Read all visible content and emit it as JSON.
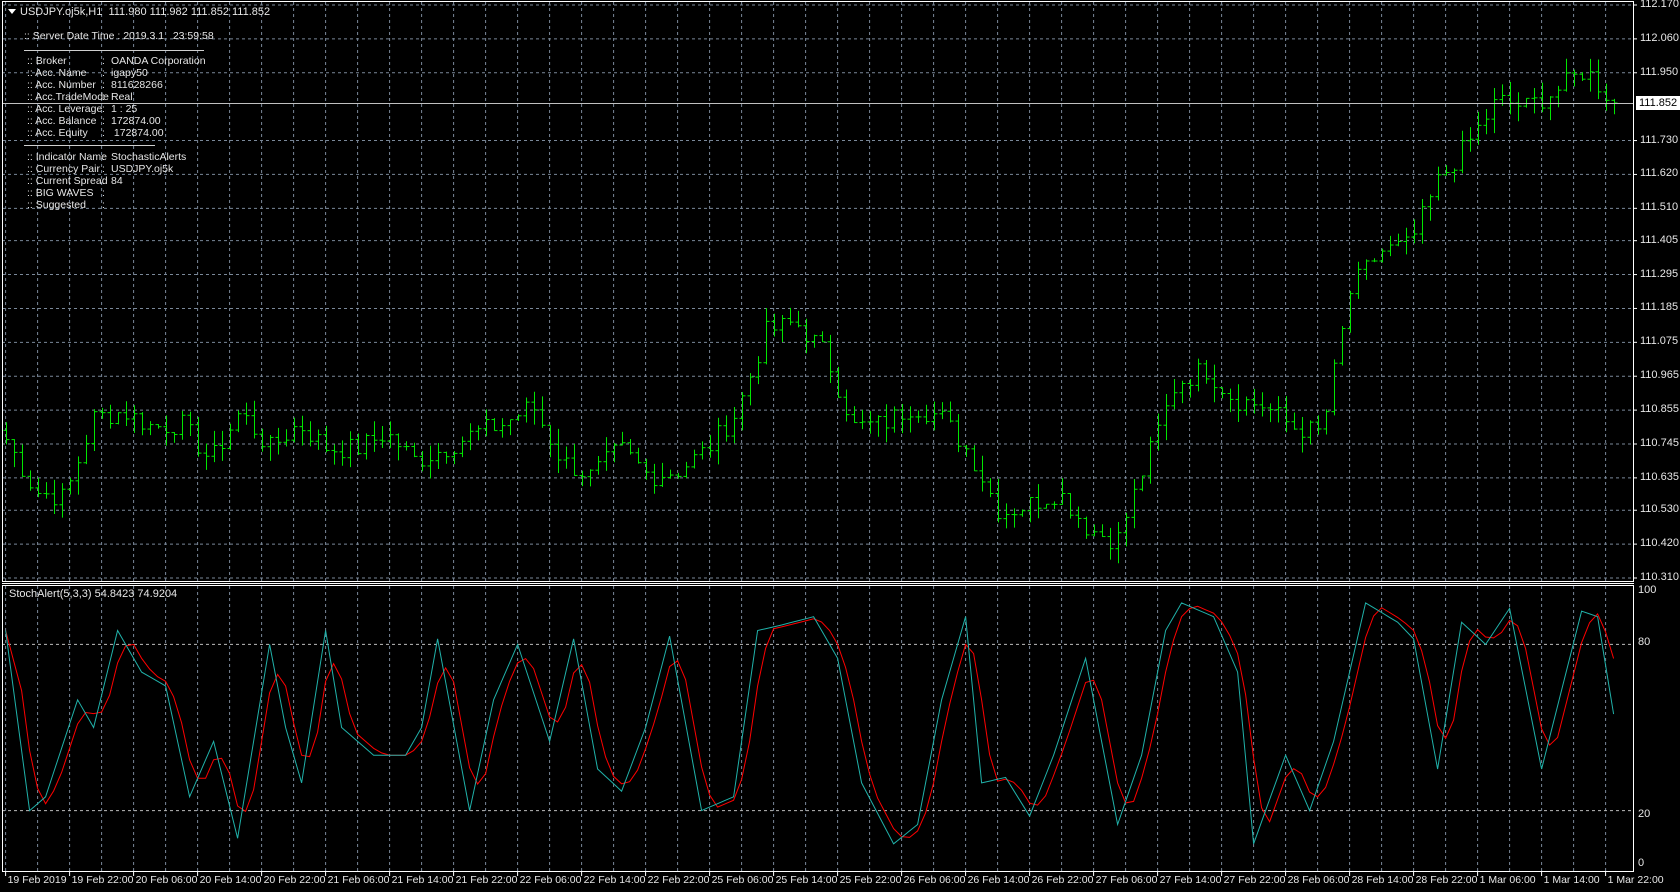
{
  "header": {
    "title": "USDJPY.oj5k,H1  111.980 111.982 111.852 111.852"
  },
  "info_panel": {
    "server_time": ":: Server Date Time : 2019.3.1   23:59:58",
    "rows_account": [
      {
        "label": ":: Broker",
        "value": "OANDA Corporation"
      },
      {
        "label": ":: Acc. Name",
        "value": "igapy50"
      },
      {
        "label": ":: Acc. Number",
        "value": "811628266"
      },
      {
        "label": ":: Acc.TradeMode",
        "value": "Real"
      },
      {
        "label": ":: Acc. Leverage",
        "value": "1 : 25"
      },
      {
        "label": ":: Acc. Balance",
        "value": "172874.00"
      },
      {
        "label": ":: Acc. Equity",
        "value": " 172874.00"
      }
    ],
    "rows_indicator": [
      {
        "label": ":: Indicator Name",
        "value": "StochasticAlerts"
      },
      {
        "label": ":: Currency Pair",
        "value": "USDJPY.oj5k"
      },
      {
        "label": ":: Current Spread",
        "value": "84"
      },
      {
        "label": ":: BIG WAVES",
        "value": ""
      },
      {
        "label": ":: Suggested",
        "value": ""
      }
    ]
  },
  "current_price": "111.852",
  "indicator_label": "StochAlert(5,3,3) 54.8423 74.9204",
  "colors": {
    "bar": "#00e600",
    "main": "#20b2aa",
    "signal": "#ff0000",
    "grid": "#7a8899"
  },
  "chart_data": [
    {
      "type": "ohlc",
      "title": "USDJPY.oj5k,H1",
      "bar_count": 202,
      "price_axis": {
        "ylim": [
          110.31,
          112.17
        ],
        "ticks": [
          "112.170",
          "112.060",
          "111.950",
          "111.730",
          "111.620",
          "111.510",
          "111.405",
          "111.295",
          "111.185",
          "111.075",
          "110.965",
          "110.855",
          "110.745",
          "110.635",
          "110.530",
          "110.420",
          "110.310"
        ]
      },
      "close_keypoints": [
        110.76,
        110.59,
        110.57,
        110.83,
        110.85,
        110.8,
        110.81,
        110.69,
        110.85,
        110.73,
        110.81,
        110.73,
        110.73,
        110.78,
        110.69,
        110.73,
        110.78,
        110.81,
        110.87,
        110.69,
        110.64,
        110.73,
        110.64,
        110.66,
        110.73,
        110.85,
        111.11,
        111.14,
        111.04,
        110.8,
        110.81,
        110.87,
        110.83,
        110.71,
        110.52,
        110.55,
        110.59,
        110.47,
        110.43,
        110.69,
        110.94,
        110.99,
        110.89,
        110.87,
        110.8,
        110.78,
        111.25,
        111.37,
        111.39,
        111.6,
        111.72,
        111.86,
        111.84,
        111.89,
        111.96,
        111.852
      ],
      "x_ticks": [
        "19 Feb 2019",
        "19 Feb 22:00",
        "20 Feb 06:00",
        "20 Feb 14:00",
        "20 Feb 22:00",
        "21 Feb 06:00",
        "21 Feb 14:00",
        "21 Feb 22:00",
        "22 Feb 06:00",
        "22 Feb 14:00",
        "22 Feb 22:00",
        "25 Feb 06:00",
        "25 Feb 14:00",
        "25 Feb 22:00",
        "26 Feb 06:00",
        "26 Feb 14:00",
        "26 Feb 22:00",
        "27 Feb 06:00",
        "27 Feb 14:00",
        "27 Feb 22:00",
        "28 Feb 06:00",
        "28 Feb 14:00",
        "28 Feb 22:00",
        "1 Mar 06:00",
        "1 Mar 14:00",
        "1 Mar 22:00"
      ]
    },
    {
      "type": "line",
      "title": "StochAlert(5,3,3)",
      "ylim": [
        0,
        100
      ],
      "ticks": [
        "100",
        "80",
        "20",
        "0"
      ],
      "levels": [
        80,
        20
      ],
      "main_points": [
        [
          0,
          85
        ],
        [
          3,
          20
        ],
        [
          5,
          25
        ],
        [
          9,
          60
        ],
        [
          11,
          50
        ],
        [
          14,
          85
        ],
        [
          17,
          70
        ],
        [
          20,
          65
        ],
        [
          23,
          25
        ],
        [
          26,
          45
        ],
        [
          29,
          10
        ],
        [
          33,
          80
        ],
        [
          35,
          50
        ],
        [
          37,
          30
        ],
        [
          40,
          85
        ],
        [
          42,
          50
        ],
        [
          46,
          40
        ],
        [
          50,
          40
        ],
        [
          52,
          50
        ],
        [
          54,
          82
        ],
        [
          58,
          20
        ],
        [
          61,
          60
        ],
        [
          64,
          80
        ],
        [
          68,
          45
        ],
        [
          71,
          82
        ],
        [
          74,
          35
        ],
        [
          77,
          27
        ],
        [
          80,
          50
        ],
        [
          83,
          83
        ],
        [
          87,
          20
        ],
        [
          91,
          25
        ],
        [
          94,
          85
        ],
        [
          97,
          87
        ],
        [
          101,
          90
        ],
        [
          104,
          75
        ],
        [
          107,
          30
        ],
        [
          111,
          8
        ],
        [
          114,
          15
        ],
        [
          117,
          60
        ],
        [
          120,
          90
        ],
        [
          122,
          30
        ],
        [
          125,
          32
        ],
        [
          128,
          18
        ],
        [
          131,
          40
        ],
        [
          135,
          75
        ],
        [
          139,
          15
        ],
        [
          142,
          40
        ],
        [
          145,
          85
        ],
        [
          147,
          95
        ],
        [
          151,
          90
        ],
        [
          154,
          70
        ],
        [
          156,
          8
        ],
        [
          160,
          40
        ],
        [
          163,
          20
        ],
        [
          166,
          45
        ],
        [
          170,
          95
        ],
        [
          174,
          88
        ],
        [
          176,
          82
        ],
        [
          179,
          35
        ],
        [
          182,
          88
        ],
        [
          185,
          80
        ],
        [
          188,
          93
        ],
        [
          192,
          35
        ],
        [
          197,
          92
        ],
        [
          199,
          90
        ],
        [
          201,
          54.8423
        ]
      ],
      "last_main": 54.8423,
      "last_signal": 74.9204
    }
  ]
}
